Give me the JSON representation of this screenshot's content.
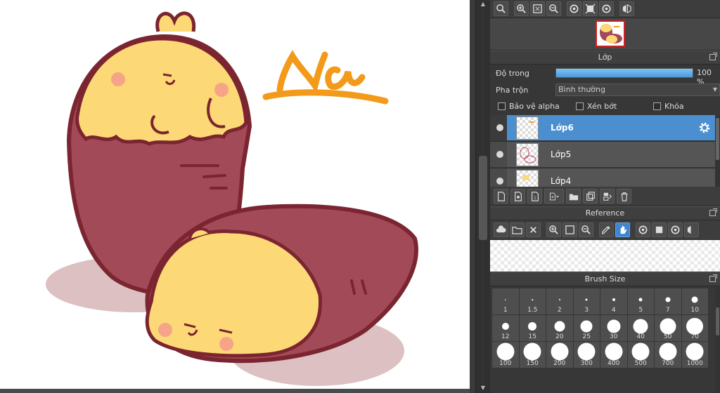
{
  "canvas": {
    "title_text": "Na",
    "colors": {
      "skin": "#a24a58",
      "flesh": "#fdd876",
      "outline": "#7a2530",
      "shadow": "#dcc0c2",
      "blush": "#f5a488",
      "orange": "#f39a1a"
    }
  },
  "top_toolbar": {
    "icons": [
      "zoom-fit-icon",
      "zoom-in-icon",
      "fit-screen-icon",
      "zoom-out-icon",
      "rotate-left-icon",
      "reset-view-icon",
      "rotate-right-icon",
      "flip-horizontal-icon"
    ]
  },
  "layer_panel": {
    "title": "Lớp",
    "opacity_label": "Độ trong",
    "opacity_value": 100,
    "opacity_text": "100 %",
    "blend_label": "Pha trộn",
    "blend_value": "Bình thường",
    "protect_alpha": "Bảo vệ alpha",
    "clipping": "Xén bớt",
    "lock": "Khóa",
    "layers": [
      {
        "name": "Lớp6",
        "selected": true
      },
      {
        "name": "Lớp5",
        "selected": false
      },
      {
        "name": "Lớp4",
        "selected": false
      }
    ]
  },
  "reference_panel": {
    "title": "Reference"
  },
  "brush_panel": {
    "title": "Brush Size",
    "sizes": [
      "1",
      "1.5",
      "2",
      "3",
      "4",
      "5",
      "7",
      "10",
      "12",
      "15",
      "20",
      "25",
      "30",
      "40",
      "50",
      "70",
      "100",
      "150",
      "200",
      "300",
      "400",
      "500",
      "700",
      "1000"
    ]
  }
}
